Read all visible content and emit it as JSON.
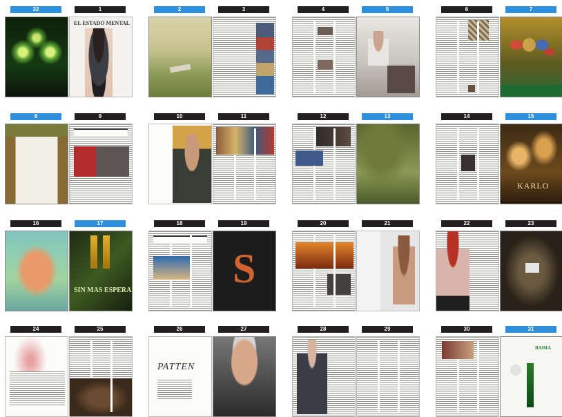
{
  "spreads": [
    {
      "left_label": "32",
      "left_ad": true,
      "right_label": "1",
      "right_ad": false
    },
    {
      "left_label": "2",
      "left_ad": true,
      "right_label": "3",
      "right_ad": false
    },
    {
      "left_label": "4",
      "left_ad": false,
      "right_label": "5",
      "right_ad": true
    },
    {
      "left_label": "6",
      "left_ad": false,
      "right_label": "7",
      "right_ad": true
    },
    {
      "left_label": "8",
      "left_ad": true,
      "right_label": "9",
      "right_ad": false
    },
    {
      "left_label": "10",
      "left_ad": false,
      "right_label": "11",
      "right_ad": false
    },
    {
      "left_label": "12",
      "left_ad": false,
      "right_label": "13",
      "right_ad": true
    },
    {
      "left_label": "14",
      "left_ad": false,
      "right_label": "15",
      "right_ad": true
    },
    {
      "left_label": "16",
      "left_ad": false,
      "right_label": "17",
      "right_ad": true
    },
    {
      "left_label": "18",
      "left_ad": false,
      "right_label": "19",
      "right_ad": false
    },
    {
      "left_label": "20",
      "left_ad": false,
      "right_label": "21",
      "right_ad": false
    },
    {
      "left_label": "22",
      "left_ad": false,
      "right_label": "23",
      "right_ad": false
    },
    {
      "left_label": "24",
      "left_ad": false,
      "right_label": "25",
      "right_ad": false
    },
    {
      "left_label": "26",
      "left_ad": false,
      "right_label": "27",
      "right_ad": false
    },
    {
      "left_label": "28",
      "left_ad": false,
      "right_label": "29",
      "right_ad": false
    },
    {
      "left_label": "30",
      "left_ad": false,
      "right_label": "31",
      "right_ad": true
    }
  ],
  "page_texts": {
    "p1_masthead": "EL ESTADO MENTAL",
    "p15_cover": "KARLO",
    "p17_ad": "SIN MAS ESPERAR",
    "p19_letter": "S",
    "p26_title": "PATTEN",
    "p31_brand": "BAHIA"
  },
  "colors": {
    "label_dark": "#231f20",
    "label_ad": "#2e8fdc",
    "page_border": "#b9b9b9"
  }
}
